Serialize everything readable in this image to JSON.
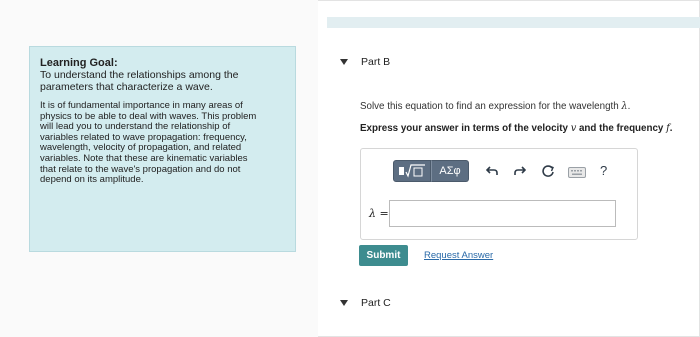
{
  "learning_goal": {
    "title": "Learning Goal:",
    "subtitle_lines": [
      "To understand the relationships among the",
      "parameters that characterize a wave."
    ],
    "body_lines": [
      "It is of fundamental importance in many areas of",
      "physics to be able to deal with waves. This problem",
      "will lead you to understand the relationship of",
      "variables related to wave propagation: frequency,",
      "wavelength, velocity of propagation, and related",
      "variables. Note that these are kinematic variables",
      "that relate to the wave's propagation and do not",
      "depend on its amplitude."
    ]
  },
  "part_b": {
    "label": "Part B",
    "instruction_prefix": "Solve this equation to find an expression for the wavelength ",
    "instruction_symbol": "λ",
    "instruction_suffix": ".",
    "bold_prefix": "Express your answer in terms of the velocity ",
    "bold_var1": "v",
    "bold_mid": " and the frequency ",
    "bold_var2": "f",
    "bold_suffix": ".",
    "toolbar": {
      "template_label": "√□",
      "symbols_label": "ΑΣφ",
      "icons": [
        "template-icon",
        "greek-symbols-icon",
        "undo-icon",
        "redo-icon",
        "reset-icon",
        "keyboard-icon",
        "help-icon"
      ],
      "help_label": "?"
    },
    "answer_label": "λ =",
    "answer_value": "",
    "submit_label": "Submit",
    "request_answer_label": "Request Answer"
  },
  "part_c": {
    "label": "Part C"
  },
  "colors": {
    "goal_bg": "#d3ecef",
    "toolbar_bg": "#5d6e82",
    "submit_bg": "#3d8c8f",
    "link": "#2a6aa8"
  }
}
